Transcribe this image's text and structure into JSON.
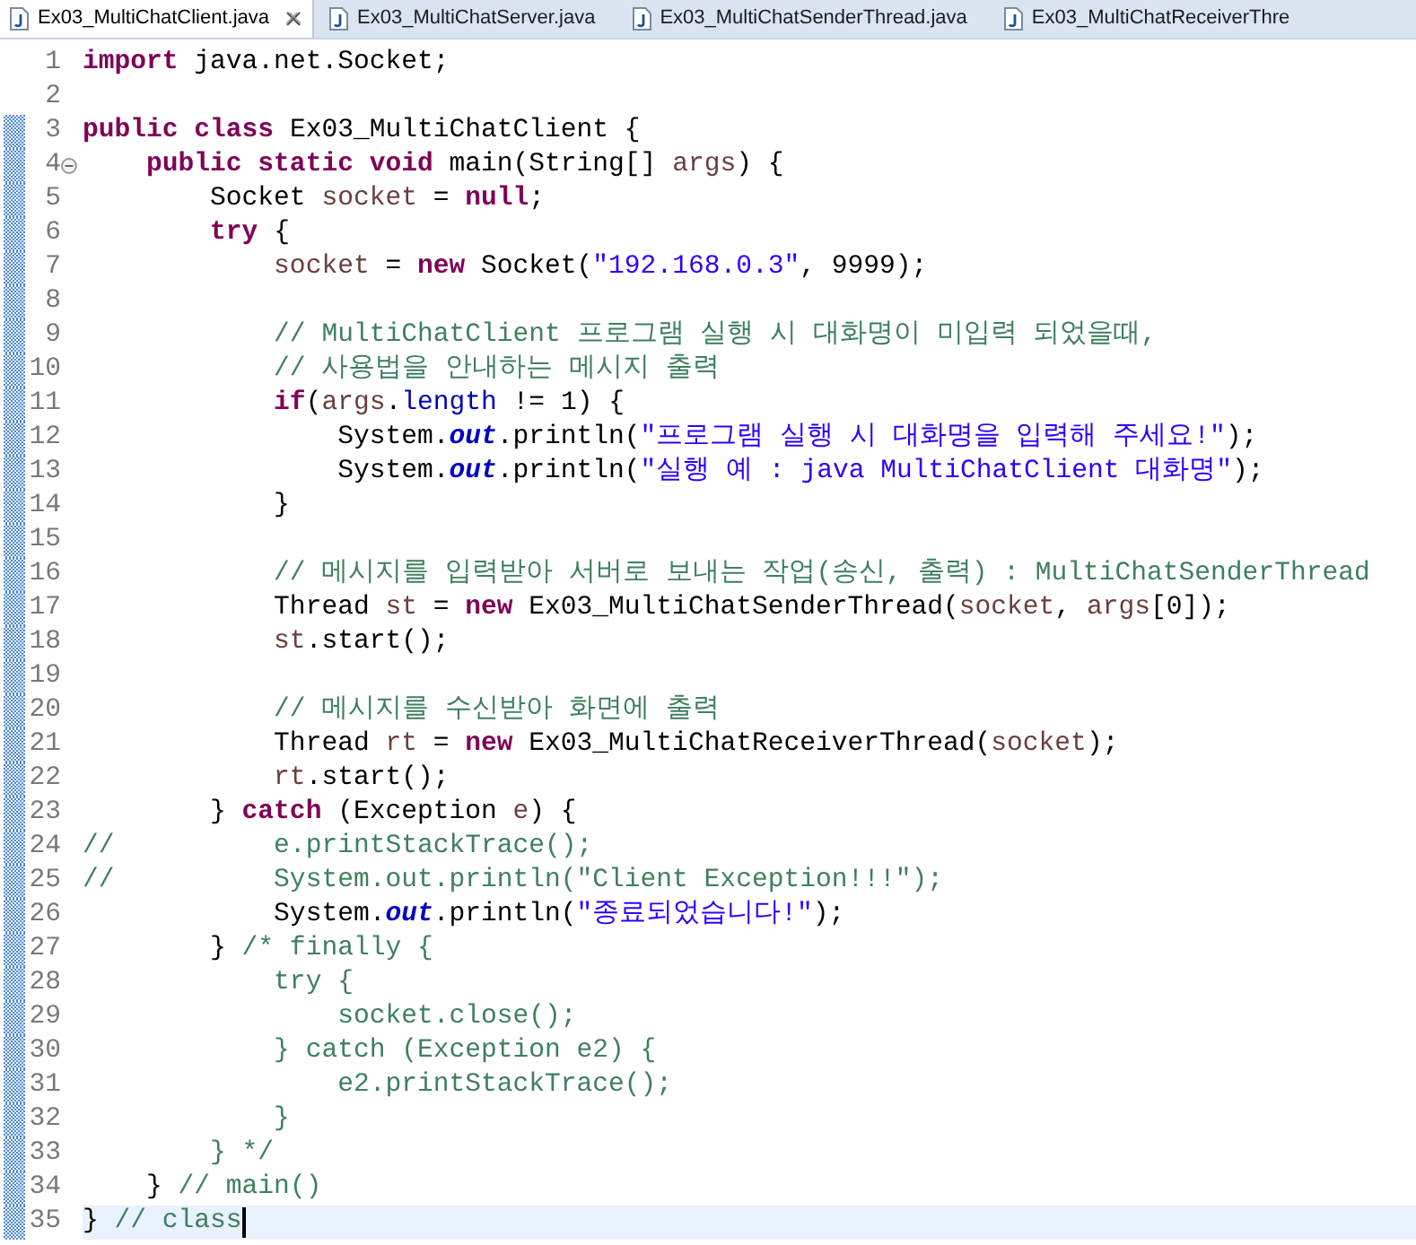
{
  "tabs": [
    {
      "label": "Ex03_MultiChatClient.java",
      "selected": true,
      "closable": true
    },
    {
      "label": "Ex03_MultiChatServer.java",
      "selected": false,
      "closable": false
    },
    {
      "label": "Ex03_MultiChatSenderThread.java",
      "selected": false,
      "closable": false
    },
    {
      "label": "Ex03_MultiChatReceiverThre",
      "selected": false,
      "closable": false
    }
  ],
  "editor": {
    "lines": [
      {
        "n": "1",
        "changed": false,
        "foldable": false,
        "current": false,
        "tokens": [
          {
            "kind": "kw",
            "text": "import"
          },
          {
            "kind": "plain",
            "text": " java.net.Socket;"
          }
        ]
      },
      {
        "n": "2",
        "changed": false,
        "foldable": false,
        "current": false
      },
      {
        "n": "3",
        "changed": true,
        "foldable": false,
        "current": false,
        "tokens": [
          {
            "kind": "kw",
            "text": "public class"
          },
          {
            "kind": "plain",
            "text": " Ex03_MultiChatClient {"
          }
        ]
      },
      {
        "n": "4",
        "changed": true,
        "foldable": true,
        "current": false,
        "tokens": [
          {
            "kind": "kw",
            "text": "    public static void"
          },
          {
            "kind": "plain",
            "text": " main(String[] "
          },
          {
            "kind": "var",
            "text": "args"
          },
          {
            "kind": "plain",
            "text": ") {"
          }
        ]
      },
      {
        "n": "5",
        "changed": true,
        "foldable": false,
        "current": false,
        "tokens": [
          {
            "kind": "plain",
            "text": "        Socket "
          },
          {
            "kind": "var",
            "text": "socket"
          },
          {
            "kind": "plain",
            "text": " = "
          },
          {
            "kind": "kw",
            "text": "null"
          },
          {
            "kind": "plain",
            "text": ";"
          }
        ]
      },
      {
        "n": "6",
        "changed": true,
        "foldable": false,
        "current": false,
        "tokens": [
          {
            "kind": "kw",
            "text": "        try"
          },
          {
            "kind": "plain",
            "text": " {"
          }
        ]
      },
      {
        "n": "7",
        "changed": true,
        "foldable": false,
        "current": false,
        "tokens": [
          {
            "kind": "var",
            "text": "            socket"
          },
          {
            "kind": "plain",
            "text": " = "
          },
          {
            "kind": "kw",
            "text": "new"
          },
          {
            "kind": "plain",
            "text": " Socket("
          },
          {
            "kind": "str",
            "text": "\"192.168.0.3\""
          },
          {
            "kind": "plain",
            "text": ", 9999);"
          }
        ]
      },
      {
        "n": "8",
        "changed": true,
        "foldable": false,
        "current": false
      },
      {
        "n": "9",
        "changed": true,
        "foldable": false,
        "current": false,
        "tokens": [
          {
            "kind": "cm",
            "text": "            // MultiChatClient 프로그램 실행 시 대화명이 미입력 되었을때,"
          }
        ]
      },
      {
        "n": "10",
        "changed": true,
        "foldable": false,
        "current": false,
        "tokens": [
          {
            "kind": "cm",
            "text": "            // 사용법을 안내하는 메시지 출력"
          }
        ]
      },
      {
        "n": "11",
        "changed": true,
        "foldable": false,
        "current": false,
        "tokens": [
          {
            "kind": "kw",
            "text": "            if"
          },
          {
            "kind": "plain",
            "text": "("
          },
          {
            "kind": "var",
            "text": "args"
          },
          {
            "kind": "plain",
            "text": "."
          },
          {
            "kind": "field",
            "text": "length"
          },
          {
            "kind": "plain",
            "text": " != 1) {"
          }
        ]
      },
      {
        "n": "12",
        "changed": true,
        "foldable": false,
        "current": false,
        "tokens": [
          {
            "kind": "plain",
            "text": "                System."
          },
          {
            "kind": "static",
            "text": "out"
          },
          {
            "kind": "plain",
            "text": ".println("
          },
          {
            "kind": "str",
            "text": "\"프로그램 실행 시 대화명을 입력해 주세요!\""
          },
          {
            "kind": "plain",
            "text": ");"
          }
        ]
      },
      {
        "n": "13",
        "changed": true,
        "foldable": false,
        "current": false,
        "tokens": [
          {
            "kind": "plain",
            "text": "                System."
          },
          {
            "kind": "static",
            "text": "out"
          },
          {
            "kind": "plain",
            "text": ".println("
          },
          {
            "kind": "str",
            "text": "\"실행 예 : java MultiChatClient 대화명\""
          },
          {
            "kind": "plain",
            "text": ");"
          }
        ]
      },
      {
        "n": "14",
        "changed": true,
        "foldable": false,
        "current": false,
        "tokens": [
          {
            "kind": "plain",
            "text": "            }"
          }
        ]
      },
      {
        "n": "15",
        "changed": true,
        "foldable": false,
        "current": false
      },
      {
        "n": "16",
        "changed": true,
        "foldable": false,
        "current": false,
        "tokens": [
          {
            "kind": "cm",
            "text": "            // 메시지를 입력받아 서버로 보내는 작업(송신, 출력) : MultiChatSenderThread"
          }
        ]
      },
      {
        "n": "17",
        "changed": true,
        "foldable": false,
        "current": false,
        "tokens": [
          {
            "kind": "plain",
            "text": "            Thread "
          },
          {
            "kind": "var",
            "text": "st"
          },
          {
            "kind": "plain",
            "text": " = "
          },
          {
            "kind": "kw",
            "text": "new"
          },
          {
            "kind": "plain",
            "text": " Ex03_MultiChatSenderThread("
          },
          {
            "kind": "var",
            "text": "socket"
          },
          {
            "kind": "plain",
            "text": ", "
          },
          {
            "kind": "var",
            "text": "args"
          },
          {
            "kind": "plain",
            "text": "[0]);"
          }
        ]
      },
      {
        "n": "18",
        "changed": true,
        "foldable": false,
        "current": false,
        "tokens": [
          {
            "kind": "var",
            "text": "            st"
          },
          {
            "kind": "plain",
            "text": ".start();"
          }
        ]
      },
      {
        "n": "19",
        "changed": true,
        "foldable": false,
        "current": false
      },
      {
        "n": "20",
        "changed": true,
        "foldable": false,
        "current": false,
        "tokens": [
          {
            "kind": "cm",
            "text": "            // 메시지를 수신받아 화면에 출력"
          }
        ]
      },
      {
        "n": "21",
        "changed": true,
        "foldable": false,
        "current": false,
        "tokens": [
          {
            "kind": "plain",
            "text": "            Thread "
          },
          {
            "kind": "var",
            "text": "rt"
          },
          {
            "kind": "plain",
            "text": " = "
          },
          {
            "kind": "kw",
            "text": "new"
          },
          {
            "kind": "plain",
            "text": " Ex03_MultiChatReceiverThread("
          },
          {
            "kind": "var",
            "text": "socket"
          },
          {
            "kind": "plain",
            "text": ");"
          }
        ]
      },
      {
        "n": "22",
        "changed": true,
        "foldable": false,
        "current": false,
        "tokens": [
          {
            "kind": "var",
            "text": "            rt"
          },
          {
            "kind": "plain",
            "text": ".start();"
          }
        ]
      },
      {
        "n": "23",
        "changed": true,
        "foldable": false,
        "current": false,
        "tokens": [
          {
            "kind": "plain",
            "text": "        } "
          },
          {
            "kind": "kw",
            "text": "catch"
          },
          {
            "kind": "plain",
            "text": " (Exception "
          },
          {
            "kind": "var",
            "text": "e"
          },
          {
            "kind": "plain",
            "text": ") {"
          }
        ]
      },
      {
        "n": "24",
        "changed": true,
        "foldable": false,
        "current": false,
        "tokens": [
          {
            "kind": "cm",
            "text": "//          e.printStackTrace();"
          }
        ]
      },
      {
        "n": "25",
        "changed": true,
        "foldable": false,
        "current": false,
        "tokens": [
          {
            "kind": "cm",
            "text": "//          System.out.println(\"Client Exception!!!\");"
          }
        ]
      },
      {
        "n": "26",
        "changed": true,
        "foldable": false,
        "current": false,
        "tokens": [
          {
            "kind": "plain",
            "text": "            System."
          },
          {
            "kind": "static",
            "text": "out"
          },
          {
            "kind": "plain",
            "text": ".println("
          },
          {
            "kind": "str",
            "text": "\"종료되었습니다!\""
          },
          {
            "kind": "plain",
            "text": ");"
          }
        ]
      },
      {
        "n": "27",
        "changed": true,
        "foldable": false,
        "current": false,
        "tokens": [
          {
            "kind": "plain",
            "text": "        } "
          },
          {
            "kind": "cm",
            "text": "/* finally {"
          }
        ]
      },
      {
        "n": "28",
        "changed": true,
        "foldable": false,
        "current": false,
        "tokens": [
          {
            "kind": "cm",
            "text": "            try {"
          }
        ]
      },
      {
        "n": "29",
        "changed": true,
        "foldable": false,
        "current": false,
        "tokens": [
          {
            "kind": "cm",
            "text": "                socket.close();"
          }
        ]
      },
      {
        "n": "30",
        "changed": true,
        "foldable": false,
        "current": false,
        "tokens": [
          {
            "kind": "cm",
            "text": "            } catch (Exception e2) {"
          }
        ]
      },
      {
        "n": "31",
        "changed": true,
        "foldable": false,
        "current": false,
        "tokens": [
          {
            "kind": "cm",
            "text": "                e2.printStackTrace();"
          }
        ]
      },
      {
        "n": "32",
        "changed": true,
        "foldable": false,
        "current": false,
        "tokens": [
          {
            "kind": "cm",
            "text": "            }"
          }
        ]
      },
      {
        "n": "33",
        "changed": true,
        "foldable": false,
        "current": false,
        "tokens": [
          {
            "kind": "cm",
            "text": "        } */"
          }
        ]
      },
      {
        "n": "34",
        "changed": true,
        "foldable": false,
        "current": false,
        "tokens": [
          {
            "kind": "plain",
            "text": "    } "
          },
          {
            "kind": "cm",
            "text": "// main()"
          }
        ]
      },
      {
        "n": "35",
        "changed": true,
        "foldable": false,
        "current": true,
        "tokens": [
          {
            "kind": "plain",
            "text": "} "
          },
          {
            "kind": "cm",
            "text": "// class"
          }
        ]
      }
    ]
  }
}
